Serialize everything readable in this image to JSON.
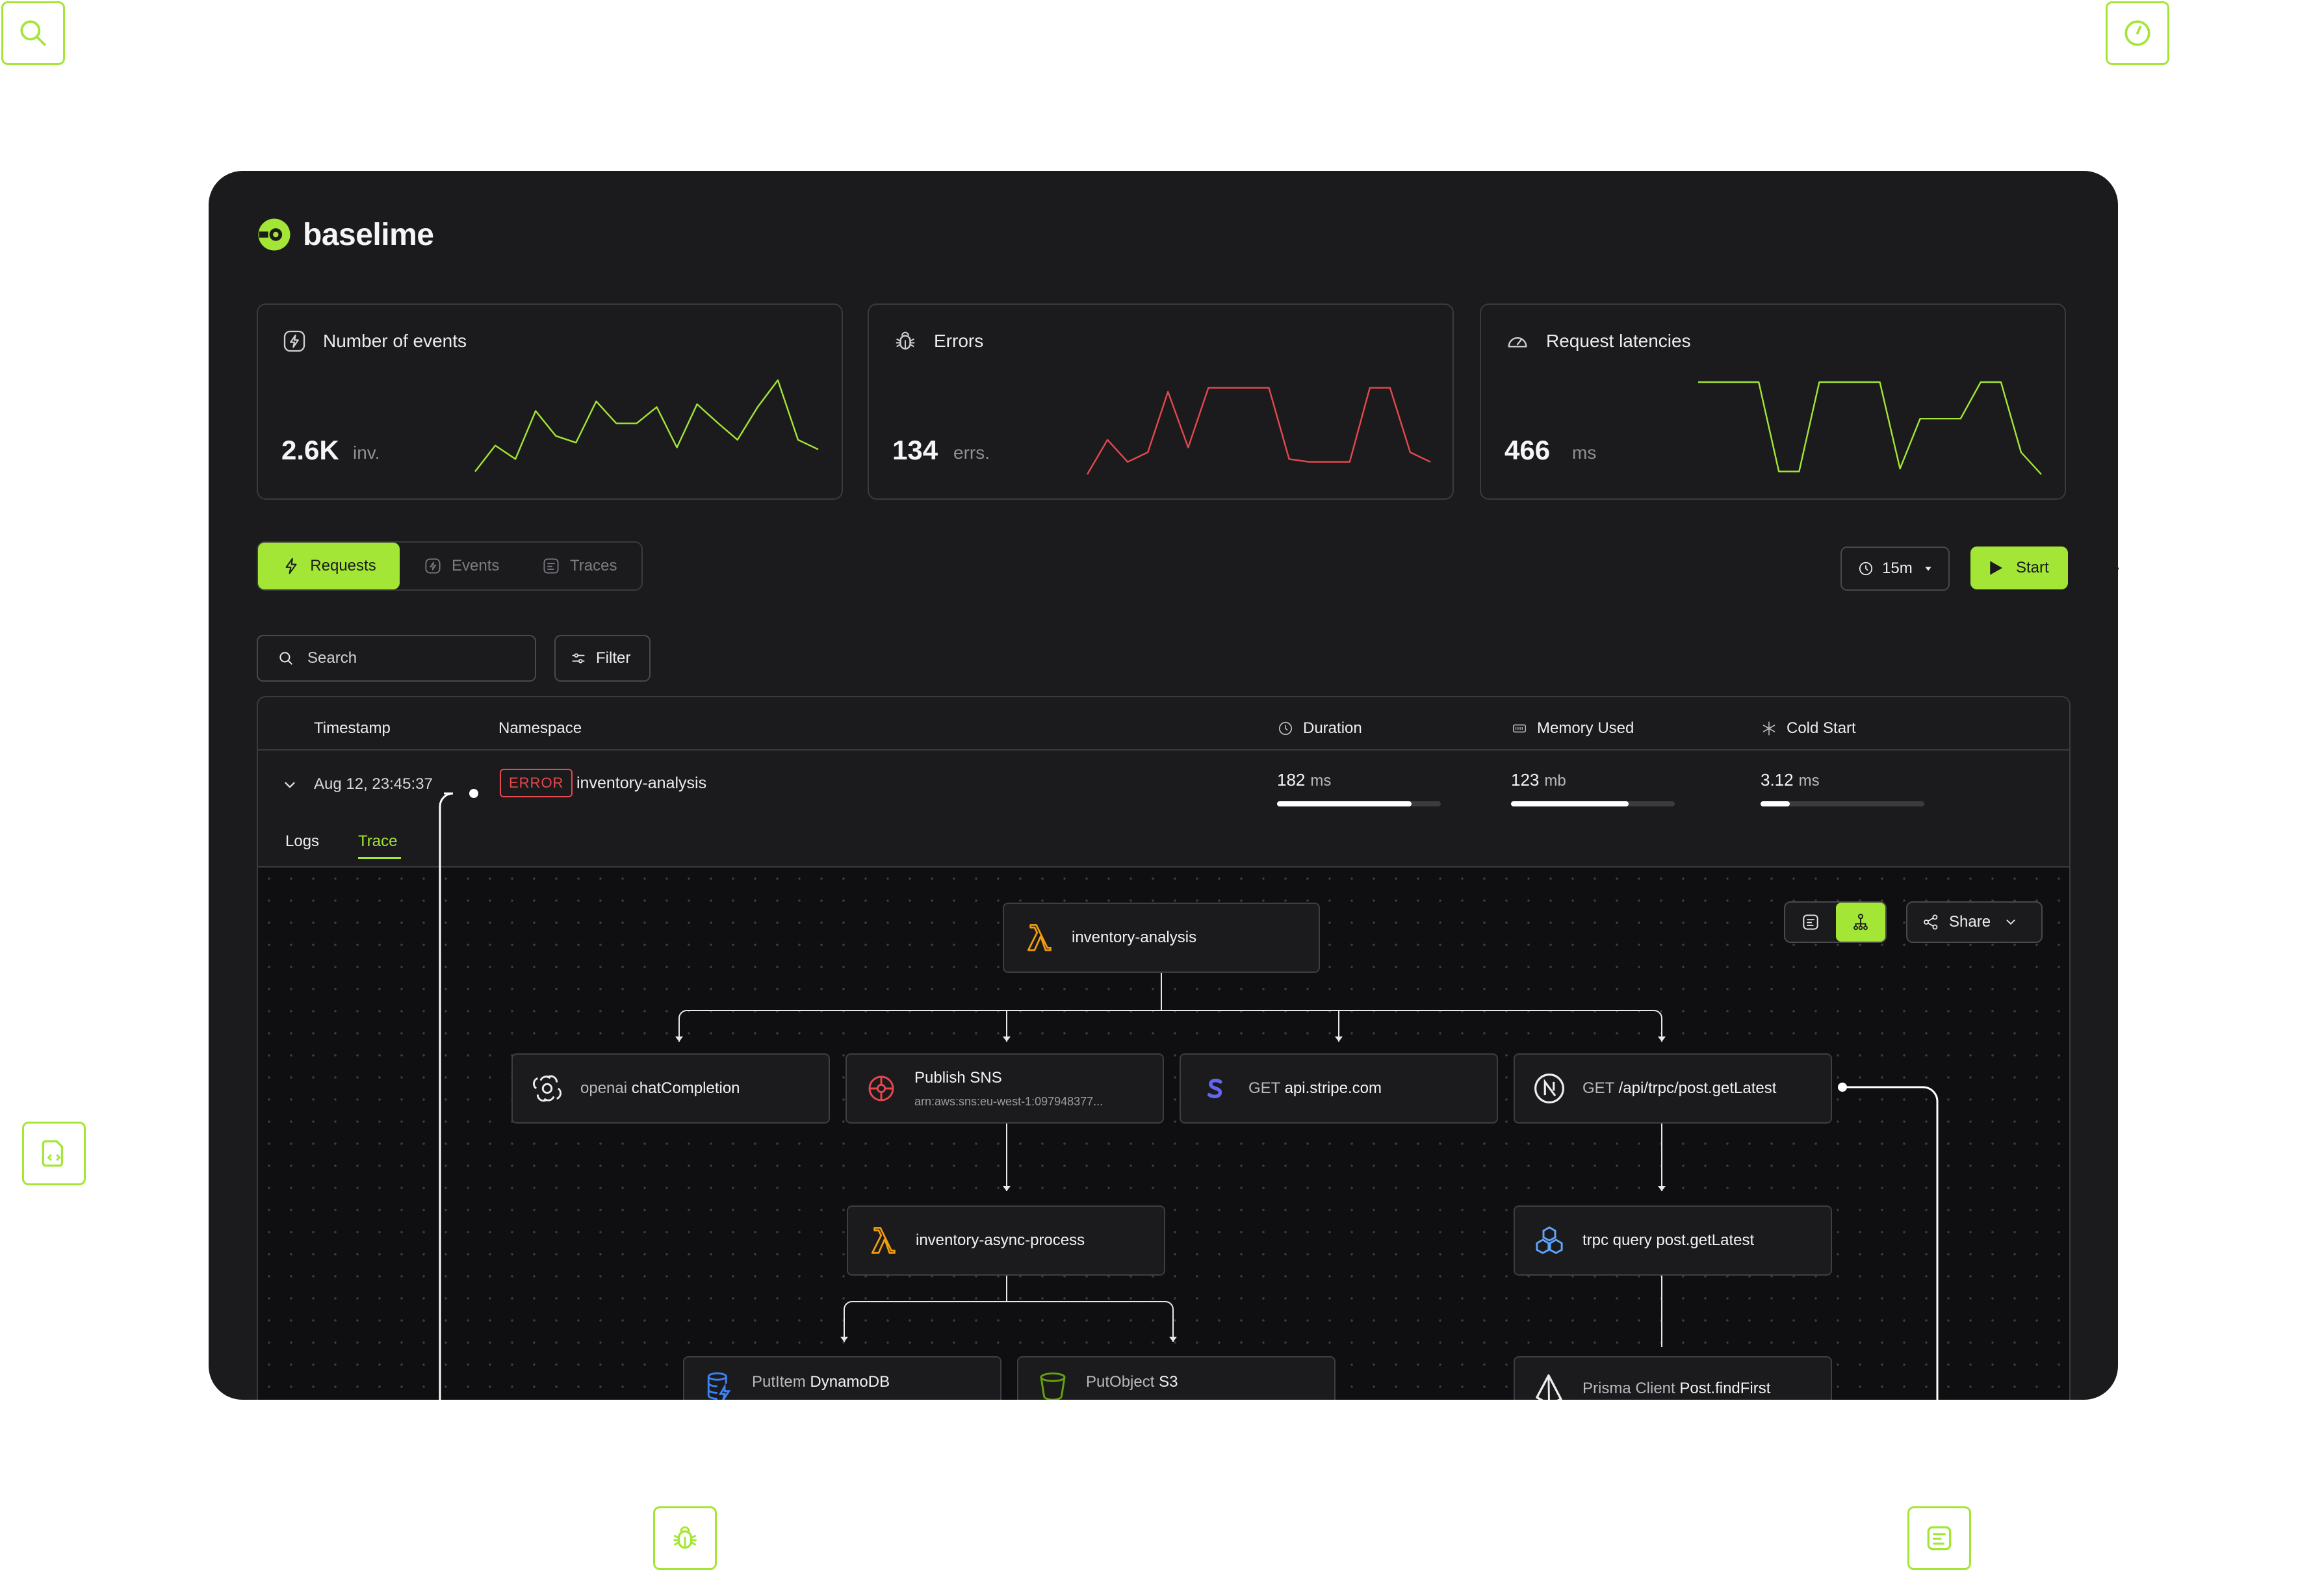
{
  "floating_icons": [
    "search-icon",
    "clock-icon",
    "code-file-icon",
    "bug-icon",
    "trace-list-icon"
  ],
  "brand": {
    "name": "baselime",
    "accent": "#a3e635"
  },
  "stats": [
    {
      "title": "Number of events",
      "icon": "bolt-icon",
      "value": "2.6K",
      "unit": "inv.",
      "color": "#a3e635",
      "spark": [
        0.05,
        0.32,
        0.18,
        0.68,
        0.42,
        0.35,
        0.78,
        0.55,
        0.55,
        0.72,
        0.3,
        0.75,
        0.56,
        0.38,
        0.72,
        1.0,
        0.38,
        0.28
      ]
    },
    {
      "title": "Errors",
      "icon": "bug-icon",
      "value": "134",
      "unit": "errs.",
      "color": "#e5484d",
      "spark": [
        0.02,
        0.38,
        0.15,
        0.25,
        0.88,
        0.3,
        0.92,
        0.92,
        0.92,
        0.92,
        0.18,
        0.15,
        0.15,
        0.15,
        0.92,
        0.92,
        0.25,
        0.15
      ]
    },
    {
      "title": "Request latencies",
      "icon": "gauge-icon",
      "value": "466",
      "unit": "ms",
      "color": "#a3e635",
      "spark": [
        0.98,
        0.98,
        0.98,
        0.98,
        0.05,
        0.05,
        0.98,
        0.98,
        0.98,
        0.98,
        0.08,
        0.6,
        0.6,
        0.6,
        0.98,
        0.98,
        0.25,
        0.02
      ]
    }
  ],
  "tabs": [
    {
      "label": "Requests",
      "icon": "bolt-icon",
      "active": true
    },
    {
      "label": "Events",
      "icon": "event-icon",
      "active": false
    },
    {
      "label": "Traces",
      "icon": "trace-icon",
      "active": false
    }
  ],
  "toolbar": {
    "time_range": "15m",
    "start_label": "Start"
  },
  "search": {
    "placeholder": "Search",
    "filter_label": "Filter"
  },
  "table": {
    "columns": [
      "Timestamp",
      "Namespace",
      "Duration",
      "Memory Used",
      "Cold Start"
    ],
    "row": {
      "timestamp": "Aug 12, 23:45:37",
      "status": "ERROR",
      "namespace": "inventory-analysis",
      "duration": {
        "value": "182",
        "unit": "ms",
        "fraction": 0.82
      },
      "memory": {
        "value": "123",
        "unit": "mb",
        "fraction": 0.72
      },
      "cold_start": {
        "value": "3.12",
        "unit": "ms",
        "fraction": 0.18
      }
    },
    "detail_tabs": [
      {
        "label": "Logs",
        "active": false
      },
      {
        "label": "Trace",
        "active": true
      }
    ]
  },
  "trace": {
    "share_label": "Share",
    "root": {
      "label": "inventory-analysis",
      "icon": "lambda-icon"
    },
    "level1": [
      {
        "prefix": "openai",
        "label": "chatCompletion",
        "icon": "openai-icon"
      },
      {
        "prefix": "Publish",
        "label": "SNS",
        "sub": "arn:aws:sns:eu-west-1:097948377...",
        "icon": "sns-icon"
      },
      {
        "prefix": "GET",
        "label": "api.stripe.com",
        "icon": "stripe-icon"
      },
      {
        "prefix": "GET",
        "label": "/api/trpc/post.getLatest",
        "icon": "nextjs-icon"
      }
    ],
    "level2": [
      {
        "label": "inventory-async-process",
        "icon": "lambda-icon"
      },
      {
        "prefix": "trpc query",
        "label": "post.getLatest",
        "icon": "trpc-icon"
      }
    ],
    "level3": [
      {
        "prefix": "PutItem",
        "label": "DynamoDB",
        "icon": "dynamodb-icon"
      },
      {
        "prefix": "PutObject",
        "label": "S3",
        "icon": "s3-icon"
      },
      {
        "prefix": "Prisma Client",
        "label": "Post.findFirst",
        "icon": "prisma-icon"
      }
    ]
  }
}
